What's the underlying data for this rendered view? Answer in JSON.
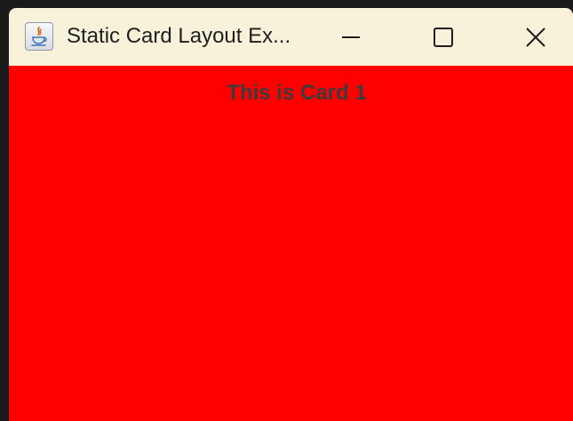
{
  "window": {
    "title": "Static Card Layout Ex...",
    "icon": "java-coffee-icon",
    "controls": {
      "minimize": "minimize-icon",
      "maximize": "maximize-icon",
      "close": "close-icon"
    }
  },
  "content": {
    "background_color": "#ff0000",
    "card_label": "This is Card 1"
  },
  "colors": {
    "titlebar": "#f9f2db",
    "label_text": "#3c3c3c"
  }
}
